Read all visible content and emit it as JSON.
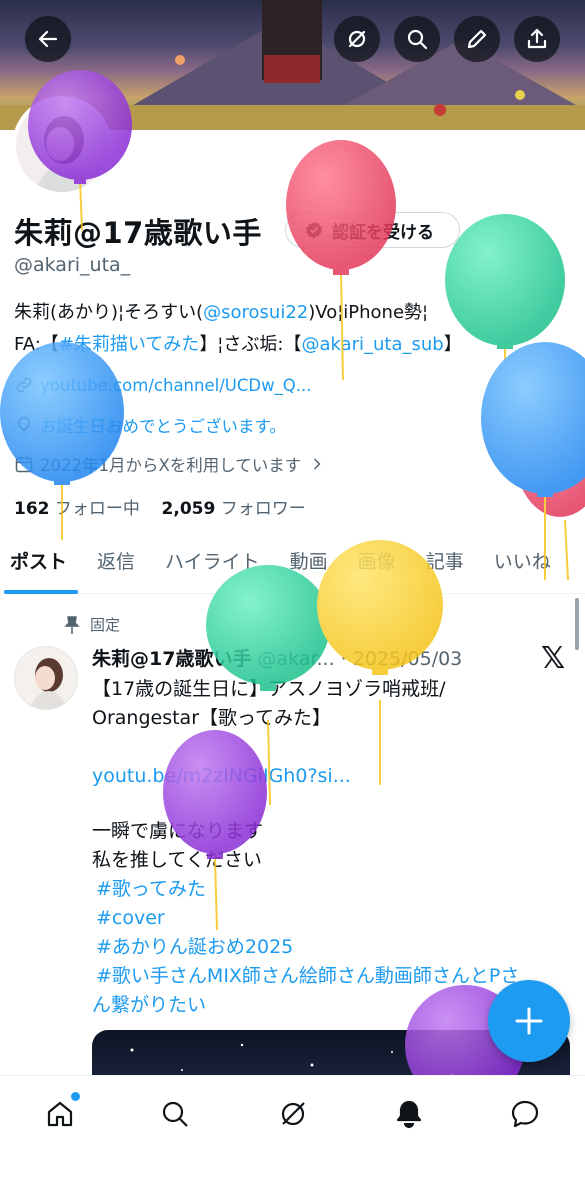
{
  "header": {
    "back_icon": "arrow-left-icon",
    "actions": [
      "grok-icon",
      "search-icon",
      "pencil-icon",
      "share-icon"
    ]
  },
  "profile": {
    "display_name": "朱莉@17歳歌い手",
    "verify_label": "認証を受ける",
    "handle": "@akari_uta_",
    "bio_line1_a": "朱莉(あかり)¦そろすい(",
    "bio_line1_link": "@sorosui22",
    "bio_line1_b": ")Vo¦iPhone勢¦",
    "bio_line2_a": "FA:【",
    "bio_line2_link1": "#朱莉描いてみた",
    "bio_line2_b": "】¦さぶ垢:【",
    "bio_line2_link2": "@akari_uta_sub",
    "bio_line2_c": "】",
    "website": "youtube.com/channel/UCDw_Q...",
    "birthday": "お誕生日おめでとうございます。",
    "joined": "2022年1月からXを利用しています",
    "following_count": "162",
    "following_label": "フォロー中",
    "followers_count": "2,059",
    "followers_label": "フォロワー"
  },
  "tabs": [
    "ポスト",
    "返信",
    "ハイライト",
    "動画",
    "画像",
    "記事",
    "いいね"
  ],
  "post": {
    "pinned_label": "固定",
    "author": "朱莉@17歳歌い手",
    "handle_date": "@akar... · 2025/05/03",
    "line1": "【17歳の誕生日に】アスノヨゾラ哨戒班/",
    "line2": "Orangestar【歌ってみた】",
    "url": "youtu.be/m2zINGiIGh0?si...",
    "line3": "一瞬で虜になります",
    "line4": "私を推してください",
    "tag1": "#歌ってみた",
    "tag2": "#cover",
    "tag3": "#あかりん誕おめ2025",
    "tag4": "#歌い手さんMIX師さん絵師さん動画師さんとPさ",
    "line5": "ん繋がりたい"
  },
  "nav": [
    "home-icon",
    "search-icon",
    "grok-icon",
    "notifications-icon",
    "messages-icon"
  ],
  "colors": {
    "accent": "#1d9bf0",
    "text": "#0f1419",
    "muted": "#536471"
  }
}
